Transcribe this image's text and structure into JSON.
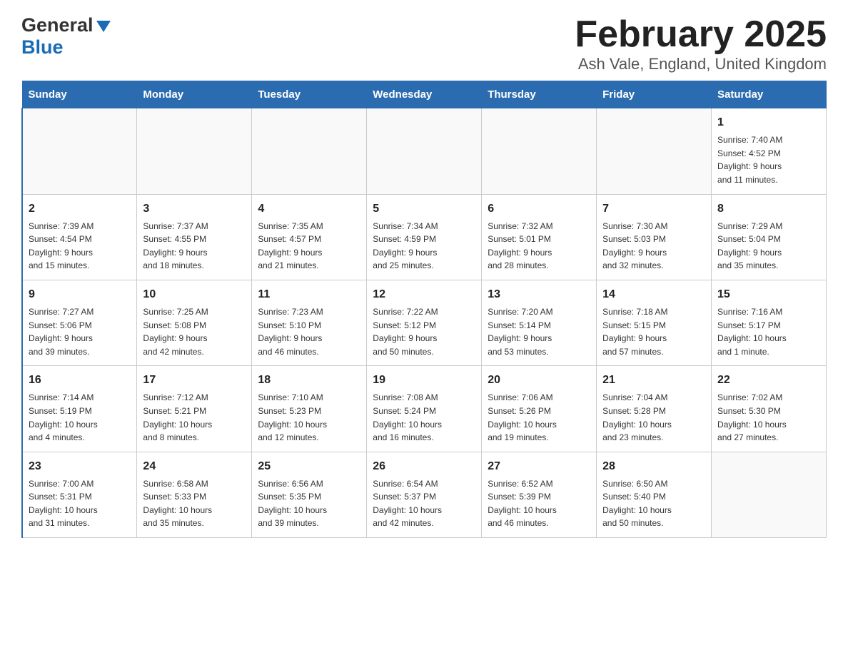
{
  "header": {
    "logo_general": "General",
    "logo_blue": "Blue",
    "title": "February 2025",
    "subtitle": "Ash Vale, England, United Kingdom"
  },
  "days_of_week": [
    "Sunday",
    "Monday",
    "Tuesday",
    "Wednesday",
    "Thursday",
    "Friday",
    "Saturday"
  ],
  "weeks": [
    [
      {
        "day": "",
        "info": ""
      },
      {
        "day": "",
        "info": ""
      },
      {
        "day": "",
        "info": ""
      },
      {
        "day": "",
        "info": ""
      },
      {
        "day": "",
        "info": ""
      },
      {
        "day": "",
        "info": ""
      },
      {
        "day": "1",
        "info": "Sunrise: 7:40 AM\nSunset: 4:52 PM\nDaylight: 9 hours\nand 11 minutes."
      }
    ],
    [
      {
        "day": "2",
        "info": "Sunrise: 7:39 AM\nSunset: 4:54 PM\nDaylight: 9 hours\nand 15 minutes."
      },
      {
        "day": "3",
        "info": "Sunrise: 7:37 AM\nSunset: 4:55 PM\nDaylight: 9 hours\nand 18 minutes."
      },
      {
        "day": "4",
        "info": "Sunrise: 7:35 AM\nSunset: 4:57 PM\nDaylight: 9 hours\nand 21 minutes."
      },
      {
        "day": "5",
        "info": "Sunrise: 7:34 AM\nSunset: 4:59 PM\nDaylight: 9 hours\nand 25 minutes."
      },
      {
        "day": "6",
        "info": "Sunrise: 7:32 AM\nSunset: 5:01 PM\nDaylight: 9 hours\nand 28 minutes."
      },
      {
        "day": "7",
        "info": "Sunrise: 7:30 AM\nSunset: 5:03 PM\nDaylight: 9 hours\nand 32 minutes."
      },
      {
        "day": "8",
        "info": "Sunrise: 7:29 AM\nSunset: 5:04 PM\nDaylight: 9 hours\nand 35 minutes."
      }
    ],
    [
      {
        "day": "9",
        "info": "Sunrise: 7:27 AM\nSunset: 5:06 PM\nDaylight: 9 hours\nand 39 minutes."
      },
      {
        "day": "10",
        "info": "Sunrise: 7:25 AM\nSunset: 5:08 PM\nDaylight: 9 hours\nand 42 minutes."
      },
      {
        "day": "11",
        "info": "Sunrise: 7:23 AM\nSunset: 5:10 PM\nDaylight: 9 hours\nand 46 minutes."
      },
      {
        "day": "12",
        "info": "Sunrise: 7:22 AM\nSunset: 5:12 PM\nDaylight: 9 hours\nand 50 minutes."
      },
      {
        "day": "13",
        "info": "Sunrise: 7:20 AM\nSunset: 5:14 PM\nDaylight: 9 hours\nand 53 minutes."
      },
      {
        "day": "14",
        "info": "Sunrise: 7:18 AM\nSunset: 5:15 PM\nDaylight: 9 hours\nand 57 minutes."
      },
      {
        "day": "15",
        "info": "Sunrise: 7:16 AM\nSunset: 5:17 PM\nDaylight: 10 hours\nand 1 minute."
      }
    ],
    [
      {
        "day": "16",
        "info": "Sunrise: 7:14 AM\nSunset: 5:19 PM\nDaylight: 10 hours\nand 4 minutes."
      },
      {
        "day": "17",
        "info": "Sunrise: 7:12 AM\nSunset: 5:21 PM\nDaylight: 10 hours\nand 8 minutes."
      },
      {
        "day": "18",
        "info": "Sunrise: 7:10 AM\nSunset: 5:23 PM\nDaylight: 10 hours\nand 12 minutes."
      },
      {
        "day": "19",
        "info": "Sunrise: 7:08 AM\nSunset: 5:24 PM\nDaylight: 10 hours\nand 16 minutes."
      },
      {
        "day": "20",
        "info": "Sunrise: 7:06 AM\nSunset: 5:26 PM\nDaylight: 10 hours\nand 19 minutes."
      },
      {
        "day": "21",
        "info": "Sunrise: 7:04 AM\nSunset: 5:28 PM\nDaylight: 10 hours\nand 23 minutes."
      },
      {
        "day": "22",
        "info": "Sunrise: 7:02 AM\nSunset: 5:30 PM\nDaylight: 10 hours\nand 27 minutes."
      }
    ],
    [
      {
        "day": "23",
        "info": "Sunrise: 7:00 AM\nSunset: 5:31 PM\nDaylight: 10 hours\nand 31 minutes."
      },
      {
        "day": "24",
        "info": "Sunrise: 6:58 AM\nSunset: 5:33 PM\nDaylight: 10 hours\nand 35 minutes."
      },
      {
        "day": "25",
        "info": "Sunrise: 6:56 AM\nSunset: 5:35 PM\nDaylight: 10 hours\nand 39 minutes."
      },
      {
        "day": "26",
        "info": "Sunrise: 6:54 AM\nSunset: 5:37 PM\nDaylight: 10 hours\nand 42 minutes."
      },
      {
        "day": "27",
        "info": "Sunrise: 6:52 AM\nSunset: 5:39 PM\nDaylight: 10 hours\nand 46 minutes."
      },
      {
        "day": "28",
        "info": "Sunrise: 6:50 AM\nSunset: 5:40 PM\nDaylight: 10 hours\nand 50 minutes."
      },
      {
        "day": "",
        "info": ""
      }
    ]
  ]
}
